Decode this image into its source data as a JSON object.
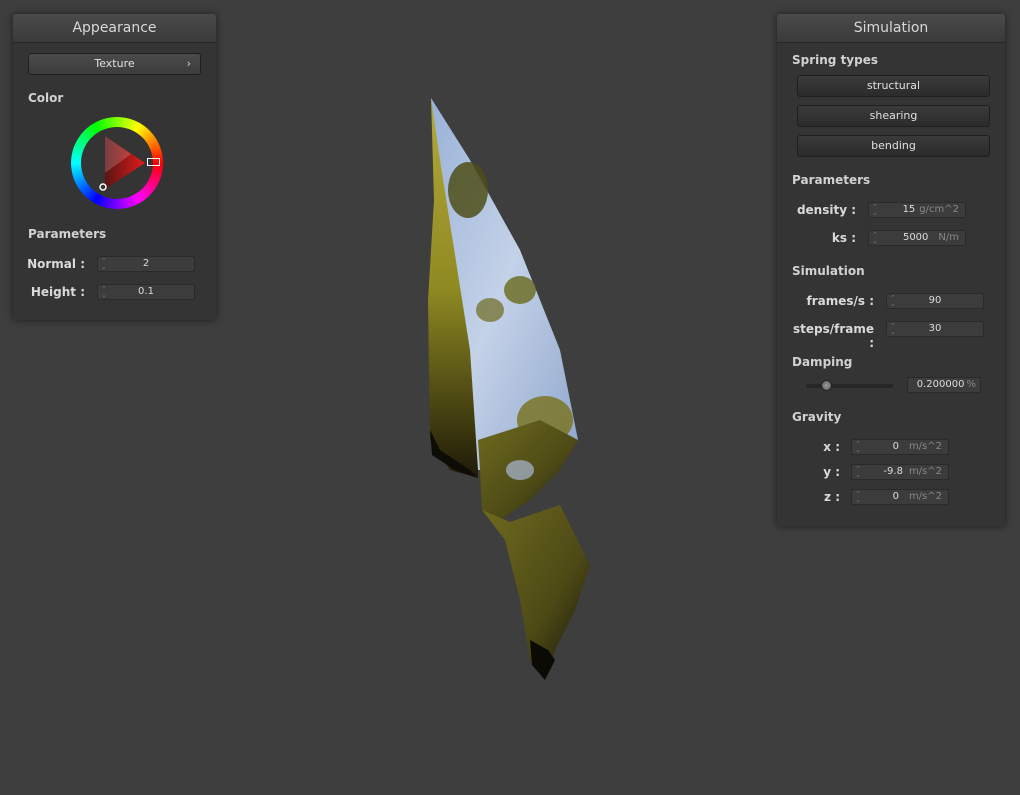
{
  "appearance": {
    "title": "Appearance",
    "texture_button": "Texture",
    "texture_chevron": "›",
    "color_label": "Color",
    "parameters_label": "Parameters",
    "normal_label": "Normal :",
    "normal_value": "2",
    "height_label": "Height :",
    "height_value": "0.1"
  },
  "simulation": {
    "title": "Simulation",
    "spring_types_label": "Spring types",
    "structural": "structural",
    "shearing": "shearing",
    "bending": "bending",
    "parameters_label": "Parameters",
    "density_label": "density :",
    "density_value": "15",
    "density_unit": "g/cm^2",
    "ks_label": "ks :",
    "ks_value": "5000",
    "ks_unit": "N/m",
    "simulation_label": "Simulation",
    "fps_label": "frames/s :",
    "fps_value": "90",
    "steps_label": "steps/frame :",
    "steps_value": "30",
    "damping_label": "Damping",
    "damping_value": "0.200000",
    "damping_unit": "%",
    "damping_slider_fraction": 0.2,
    "gravity_label": "Gravity",
    "x_label": "x :",
    "x_value": "0",
    "y_label": "y :",
    "y_value": "-9.8",
    "z_label": "z :",
    "z_value": "0",
    "gravity_unit": "m/s^2"
  },
  "colors": {
    "background": "#3e3e3e",
    "panel": "#343434",
    "picker_handle": "#e04040"
  },
  "icons": [
    "spin-arrows-icon",
    "chevron-right-icon",
    "color-wheel-icon",
    "slider-knob-icon"
  ]
}
